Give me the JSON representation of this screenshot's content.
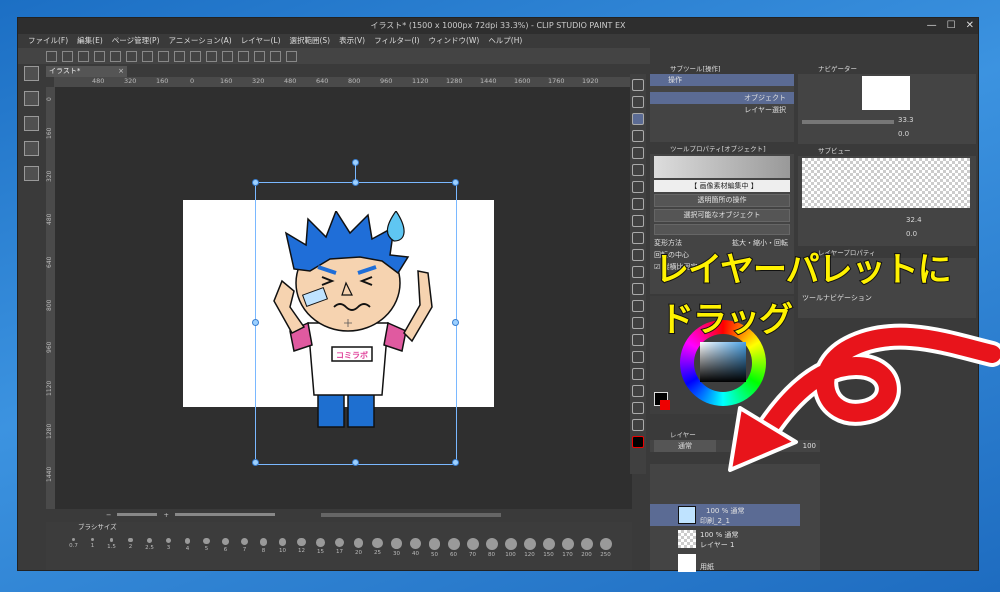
{
  "window": {
    "title": "イラスト* (1500 x 1000px 72dpi 33.3%) - CLIP STUDIO PAINT EX",
    "controls": [
      "—",
      "☐",
      "✕"
    ]
  },
  "menu": [
    "ファイル(F)",
    "編集(E)",
    "ページ管理(P)",
    "アニメーション(A)",
    "レイヤー(L)",
    "選択範囲(S)",
    "表示(V)",
    "フィルター(I)",
    "ウィンドウ(W)",
    "ヘルプ(H)"
  ],
  "document_tab": {
    "label": "イラスト*",
    "close": "×"
  },
  "ruler_h": [
    "480",
    "320",
    "160",
    "0",
    "160",
    "320",
    "480",
    "640",
    "800",
    "960",
    "1120",
    "1280",
    "1440",
    "1600",
    "1760",
    "1920"
  ],
  "ruler_v": [
    "0",
    "160",
    "320",
    "480",
    "640",
    "800",
    "960",
    "1120",
    "1280",
    "1440"
  ],
  "brush_panel": {
    "title": "ブラシサイズ",
    "sizes": [
      "0.7",
      "1",
      "1.5",
      "2",
      "2.5",
      "3",
      "4",
      "5",
      "6",
      "7",
      "8",
      "10",
      "12",
      "15",
      "17",
      "20",
      "25",
      "30",
      "40",
      "50",
      "60",
      "70",
      "80",
      "100",
      "120",
      "150",
      "170",
      "200",
      "250"
    ]
  },
  "subtool": {
    "title": "サブツール[操作]",
    "tab": "操作",
    "items": [
      "オブジェクト",
      "レイヤー選択"
    ]
  },
  "tool_property": {
    "title": "ツールプロパティ[オブジェクト]",
    "header": "【 画像素材編集中 】",
    "op_target": "透明箇所の操作",
    "selectable": "選択可能なオブジェクト",
    "transform_label": "変形方法",
    "transform_value": "拡大・縮小・回転",
    "center_label": "回転の中心",
    "aspect": "縦横比固定"
  },
  "navigator": {
    "title": "ナビゲーター",
    "zoom": "33.3",
    "angle": "0.0"
  },
  "subview": {
    "title": "サブビュー",
    "zoom": "32.4",
    "angle": "0.0"
  },
  "layer_property": {
    "title": "レイヤープロパティ",
    "tool_nav": "ツールナビゲーション"
  },
  "layer_panel": {
    "title": "レイヤー",
    "blend": "通常",
    "opacity": "100",
    "layers": [
      {
        "mode": "100 % 通常",
        "name": "印刷_2_1"
      },
      {
        "mode": "100 % 通常",
        "name": "レイヤー 1"
      },
      {
        "mode": "",
        "name": "用紙"
      }
    ]
  },
  "callout": {
    "line1": "レイヤーパレットに",
    "line2": "ドラッグ",
    "color": "#fff200",
    "arrow_color": "#e8141b"
  },
  "character": {
    "shirt_text": "コミラボ"
  }
}
